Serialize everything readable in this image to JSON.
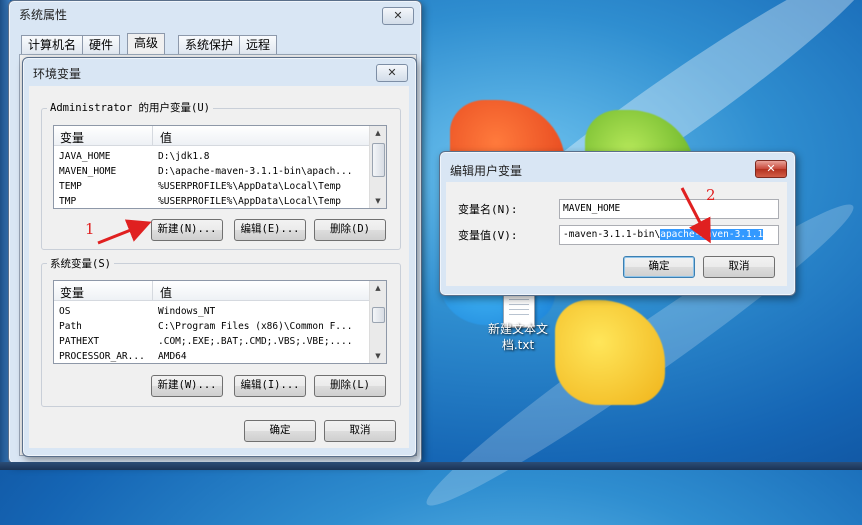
{
  "system_props": {
    "title": "系统属性",
    "tabs": [
      "计算机名",
      "硬件",
      "高级",
      "系统保护",
      "远程"
    ],
    "active_tab": "高级",
    "close": "✕"
  },
  "env_dialog": {
    "title": "环境变量",
    "close": "✕",
    "user_group_label": "Administrator 的用户变量(U)",
    "user_columns": [
      "变量",
      "值"
    ],
    "user_vars": [
      {
        "name": "JAVA_HOME",
        "value": "D:\\jdk1.8"
      },
      {
        "name": "MAVEN_HOME",
        "value": "D:\\apache-maven-3.1.1-bin\\apach..."
      },
      {
        "name": "TEMP",
        "value": "%USERPROFILE%\\AppData\\Local\\Temp"
      },
      {
        "name": "TMP",
        "value": "%USERPROFILE%\\AppData\\Local\\Temp"
      }
    ],
    "user_buttons": {
      "new": "新建(N)...",
      "edit": "编辑(E)...",
      "delete": "删除(D)"
    },
    "sys_group_label": "系统变量(S)",
    "sys_columns": [
      "变量",
      "值"
    ],
    "sys_vars": [
      {
        "name": "OS",
        "value": "Windows_NT"
      },
      {
        "name": "Path",
        "value": "C:\\Program Files (x86)\\Common F..."
      },
      {
        "name": "PATHEXT",
        "value": ".COM;.EXE;.BAT;.CMD;.VBS;.VBE;...."
      },
      {
        "name": "PROCESSOR_AR...",
        "value": "AMD64"
      }
    ],
    "sys_buttons": {
      "new": "新建(W)...",
      "edit": "编辑(I)...",
      "delete": "删除(L)"
    },
    "ok": "确定",
    "cancel": "取消"
  },
  "edit_dialog": {
    "title": "编辑用户变量",
    "close": "✕",
    "name_label": "变量名(N):",
    "name_value": "MAVEN_HOME",
    "value_label": "变量值(V):",
    "value_plain": "-maven-3.1.1-bin\\",
    "value_selected": "apache-maven-3.1.1",
    "ok": "确定",
    "cancel": "取消"
  },
  "annotations": {
    "one": "1",
    "two": "2"
  },
  "desktop": {
    "file_label_line1": "新建文本文",
    "file_label_line2": "档.txt"
  },
  "colors": {
    "annotation": "#e02020",
    "selection": "#3399ff",
    "close_red": "#c8483a"
  }
}
